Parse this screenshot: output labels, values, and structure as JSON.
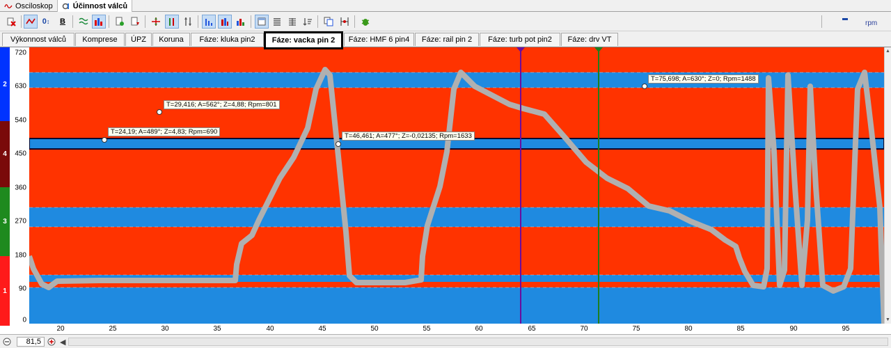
{
  "app_tabs": [
    {
      "label": "Osciloskop",
      "icon": "oscilloscope-icon"
    },
    {
      "label": "Účinnost válců",
      "icon": "gear-chart-icon"
    }
  ],
  "toolbar": {
    "buttons": [
      "delete-icon",
      "line-style-icon",
      "zero-offset-icon",
      "bold-icon",
      "wave-icon",
      "bars-color-icon",
      "export-doc-icon",
      "import-doc-icon",
      "cursor-move-icon",
      "cursor-select-icon",
      "cursor-resize-icon",
      "bar-align-left-icon",
      "bar-align-center-icon",
      "bar-chart-icon",
      "single-view-icon",
      "list-view-icon",
      "grid-view-icon",
      "sort-icon",
      "copy-icon",
      "measure-icon",
      "bug-icon"
    ],
    "zero_label": "0",
    "bold_label": "B",
    "unit_label": "rpm"
  },
  "channel_tabs": [
    "Výkonnost válců",
    "Komprese",
    "ÚPZ",
    "Koruna",
    "Fáze: kluka pin2",
    "Fáze: vacka pin 2",
    "Fáze: HMF 6 pin4",
    "Fáze: rail pin 2",
    "Fáze: turb pot pin2",
    "Fáze: drv VT"
  ],
  "active_tab": "Fáze: vacka pin 2",
  "lanes": [
    {
      "label": "2",
      "color": "#0033ff"
    },
    {
      "label": "4",
      "color": "#7a0a0a"
    },
    {
      "label": "3",
      "color": "#1e8a1e"
    },
    {
      "label": "1",
      "color": "#ff1a1a"
    }
  ],
  "y_ticks": [
    "720",
    "630",
    "540",
    "450",
    "360",
    "270",
    "180",
    "90",
    "0"
  ],
  "x_ticks": [
    "20",
    "25",
    "30",
    "35",
    "40",
    "45",
    "50",
    "55",
    "60",
    "65",
    "70",
    "75",
    "80",
    "85",
    "90",
    "95"
  ],
  "annotations": [
    {
      "text": "T=29,416; A=562°; Z=4,88; Rpm=801"
    },
    {
      "text": "T=24,19; A=489°; Z=4,83; Rpm=690"
    },
    {
      "text": "T=46,461; A=477°; Z=-0,02135; Rpm=1633"
    },
    {
      "text": "T=75,698; A=630°; Z=0; Rpm=1488"
    }
  ],
  "cursors": [
    {
      "color": "#6a0d9e",
      "x": 63.9
    },
    {
      "color": "#1e7d1e",
      "x": 71.3
    }
  ],
  "colors": {
    "red": "#ff3300",
    "blue": "#1f8ae0",
    "signal": "#b0b0b0"
  },
  "status": {
    "value": "81,5"
  }
}
